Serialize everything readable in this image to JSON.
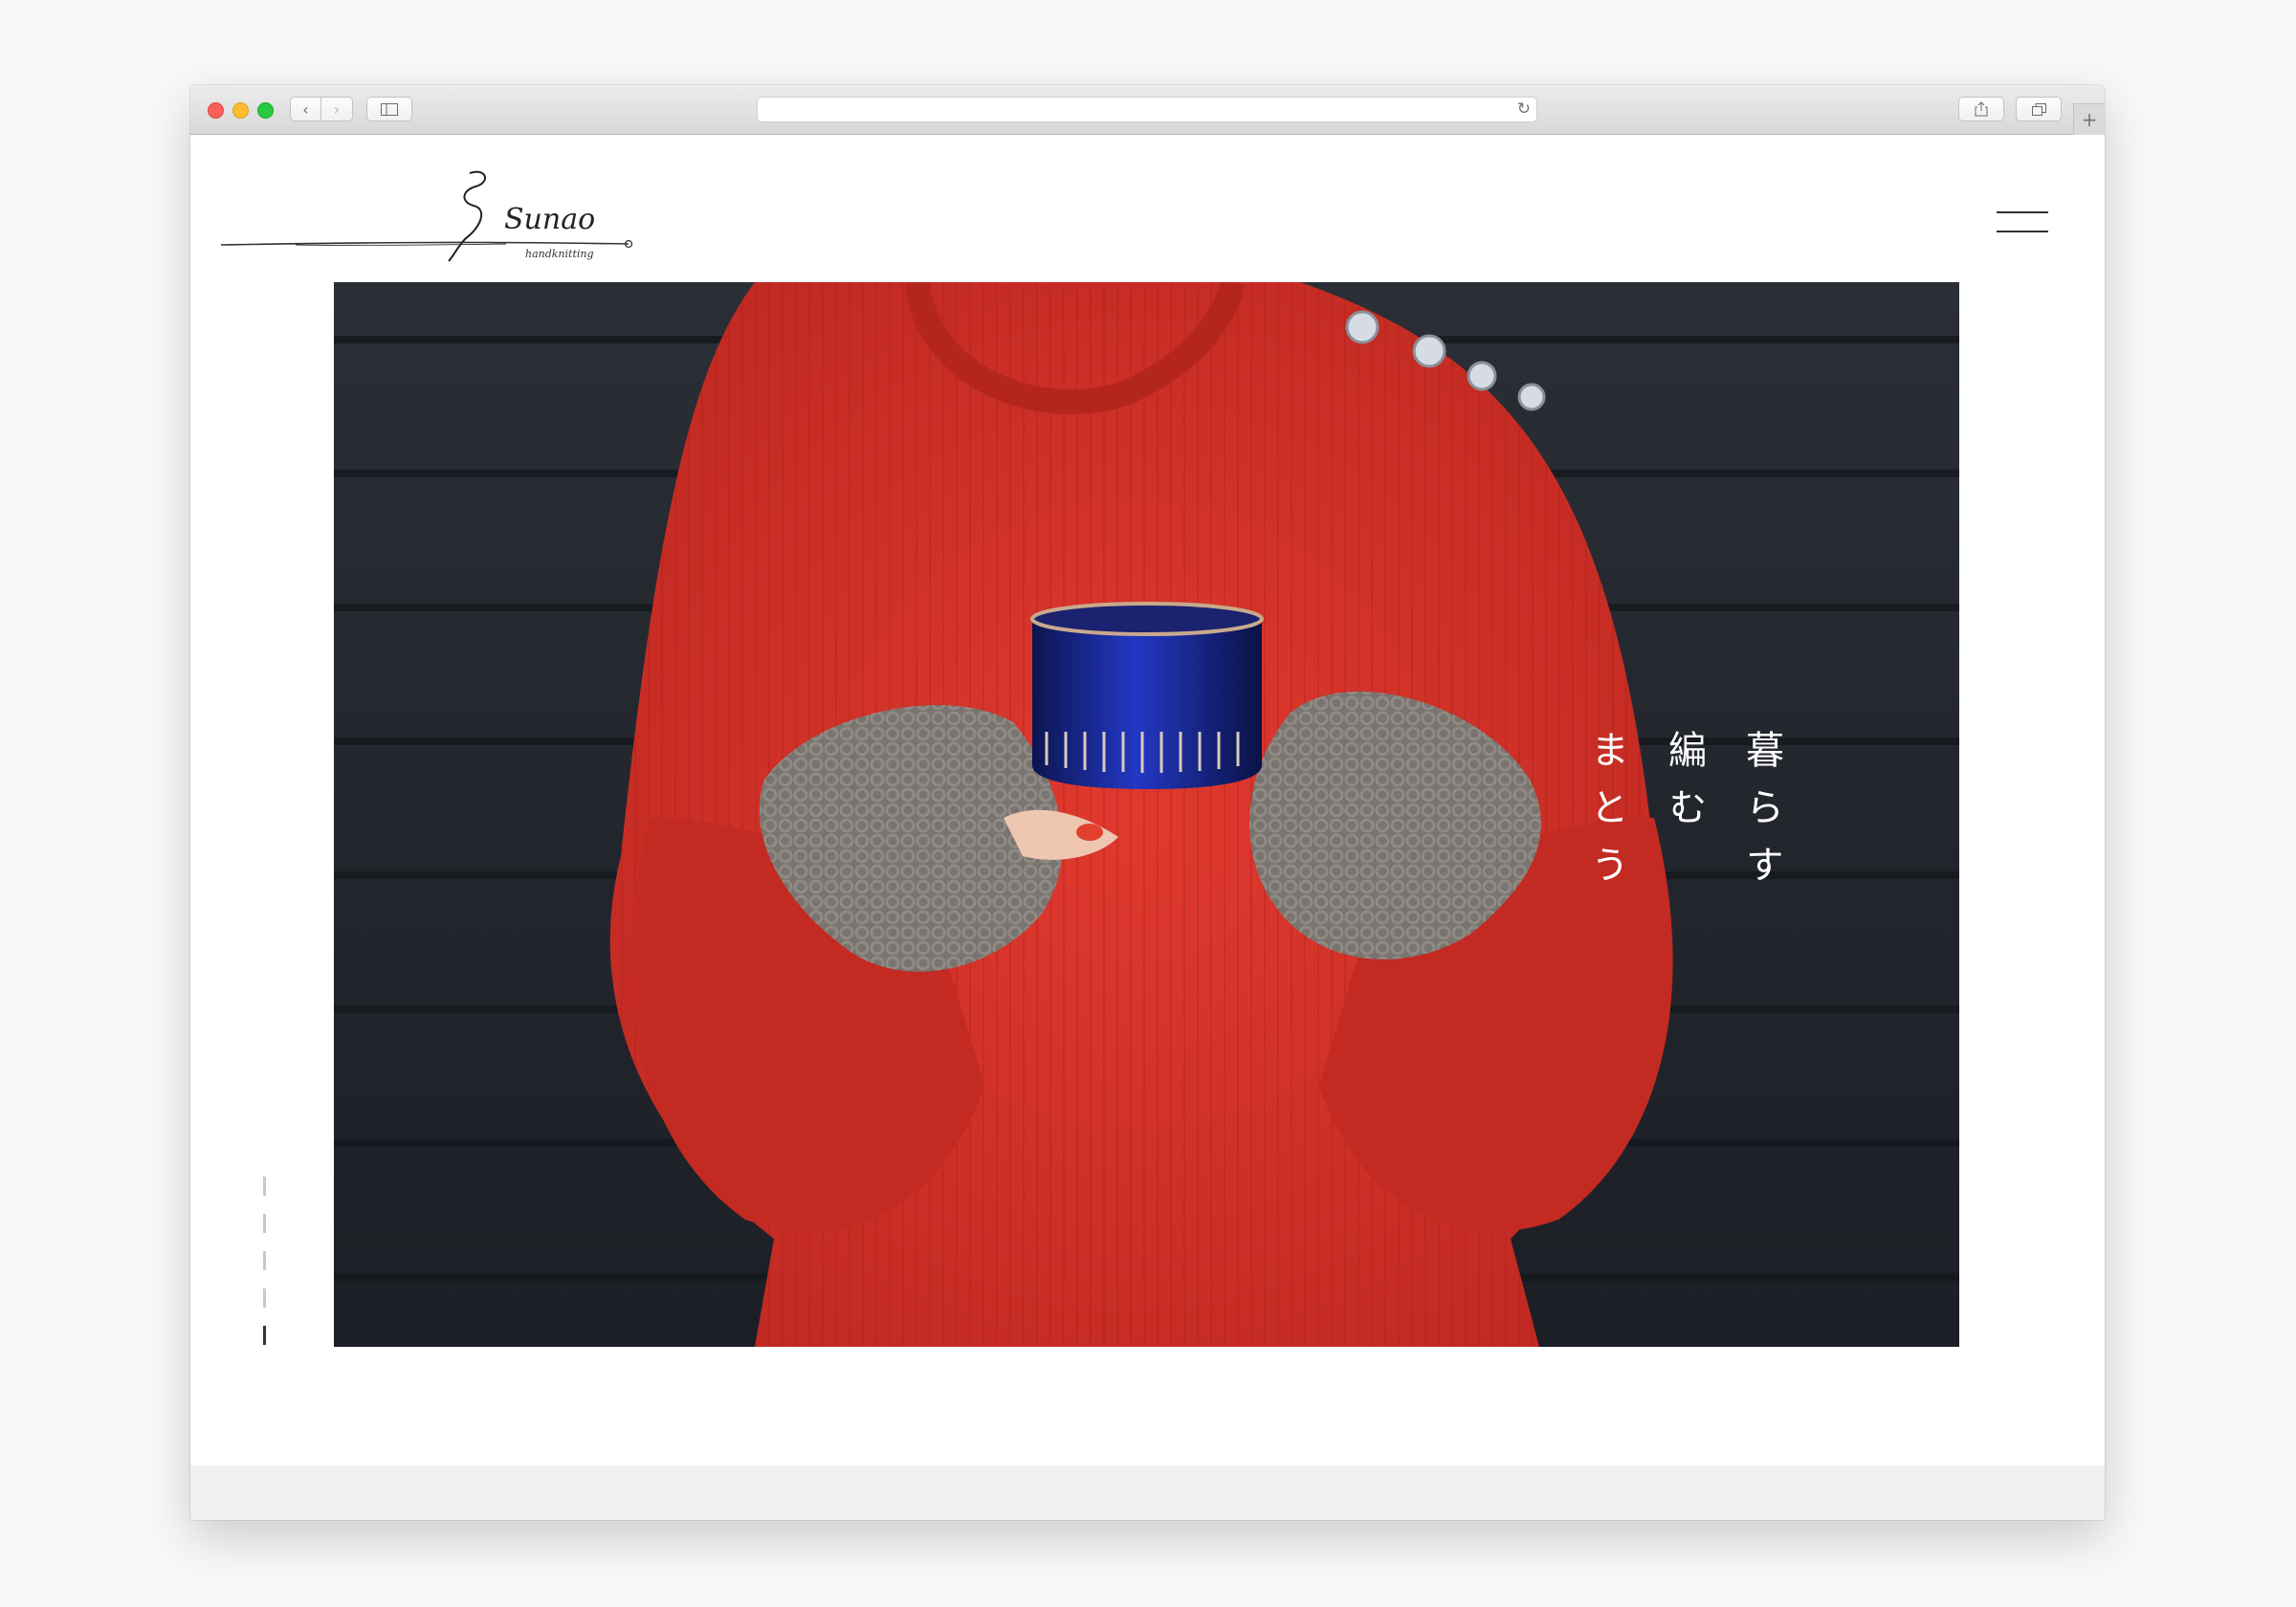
{
  "browser": {
    "url": "",
    "icons": {
      "back": "chevron-left-icon",
      "forward": "chevron-right-icon",
      "sidebar": "sidebar-icon",
      "reload": "reload-icon",
      "share": "share-icon",
      "tabs": "tabs-overview-icon",
      "new_tab": "plus-icon"
    }
  },
  "site": {
    "logo_text": "Sunao",
    "logo_subtext": "handknitting",
    "menu_icon": "hamburger-menu-icon"
  },
  "hero": {
    "tagline_columns": [
      "暮らす",
      "編む",
      "まとう"
    ],
    "image": "person-in-red-sweater-holding-blue-cup"
  },
  "slider": {
    "indicator_count": 5,
    "active_index": 4
  },
  "colors": {
    "sweater": "#d6322a",
    "background_wall": "#22262d",
    "cup": "#1a2a8f",
    "mitten": "#7a7470"
  }
}
